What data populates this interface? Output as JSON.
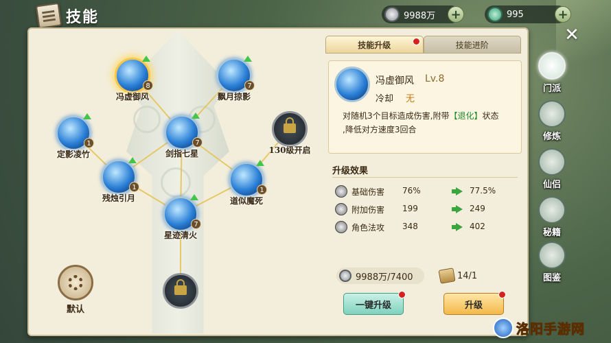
{
  "header": {
    "title": "技能"
  },
  "currency": {
    "silver": "9988万",
    "jade": "995",
    "plus_symbol": "+"
  },
  "close_symbol": "✕",
  "tree": {
    "nodes": [
      {
        "name": "冯虚御风",
        "level": "8"
      },
      {
        "name": "飘月掠影",
        "level": "7"
      },
      {
        "name": "定影凌竹",
        "level": "1"
      },
      {
        "name": "剑指七星",
        "level": "7"
      },
      {
        "name": "130级开启",
        "level": ""
      },
      {
        "name": "残烛引月",
        "level": "1"
      },
      {
        "name": "道似魔死",
        "level": "1"
      },
      {
        "name": "星迹清火",
        "level": "7"
      }
    ],
    "default_label": "默认"
  },
  "tabs": {
    "upgrade": "技能升级",
    "advance": "技能进阶"
  },
  "skill": {
    "name": "冯虚御风",
    "level": "Lv.8",
    "cooldown_label": "冷却",
    "cooldown_value": "无",
    "desc_1": "对随机3个目标造成伤害,附带",
    "desc_hl": "【退化】",
    "desc_2": "状态",
    "desc_3": ",降低对方速度3回合"
  },
  "effects": {
    "title": "升级效果",
    "rows": [
      {
        "name": "基础伤害",
        "current": "76%",
        "next": "77.5%"
      },
      {
        "name": "附加伤害",
        "current": "199",
        "next": "249"
      },
      {
        "name": "角色法攻",
        "current": "348",
        "next": "402"
      }
    ]
  },
  "cost": {
    "silver": "9988万/7400",
    "scrolls": "14/1"
  },
  "buttons": {
    "one_click": "一键升级",
    "upgrade": "升级"
  },
  "side_nav": [
    {
      "label": "门派"
    },
    {
      "label": "修炼"
    },
    {
      "label": "仙侣"
    },
    {
      "label": "秘籍"
    },
    {
      "label": "图鉴"
    }
  ],
  "watermark": "洛阳手游网",
  "colors": {
    "highlight_green": "#1f8a2a",
    "selected_glow": "#f6c74a",
    "badge_red": "#d4221c"
  }
}
